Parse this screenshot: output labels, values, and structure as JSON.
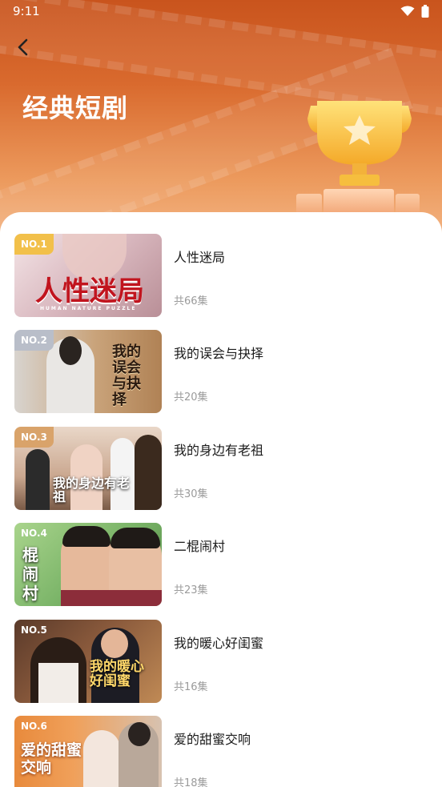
{
  "status_bar": {
    "time": "9:11"
  },
  "header": {
    "title": "经典短剧"
  },
  "items": [
    {
      "rank": "NO.1",
      "title": "人性迷局",
      "episodes": "共66集",
      "poster_title": "人性迷局",
      "poster_subtitle": "HUMAN NATURE PUZZLE",
      "rank_color": "#f2c04a"
    },
    {
      "rank": "NO.2",
      "title": "我的误会与抉择",
      "episodes": "共20集",
      "poster_title": "我的误会与抉择",
      "rank_color": "#b9bec9"
    },
    {
      "rank": "NO.3",
      "title": "我的身边有老祖",
      "episodes": "共30集",
      "poster_title": "我的身边有老祖",
      "rank_color": "#d9a36a"
    },
    {
      "rank": "NO.4",
      "title": "二棍闹村",
      "episodes": "共23集",
      "poster_title": "棍闹村",
      "rank_color": "rgba(0,0,0,0)"
    },
    {
      "rank": "NO.5",
      "title": "我的暖心好闺蜜",
      "episodes": "共16集",
      "poster_title": "我的暖心好闺蜜",
      "rank_color": "rgba(0,0,0,0)"
    },
    {
      "rank": "NO.6",
      "title": "爱的甜蜜交响",
      "episodes": "共18集",
      "poster_title": "爱的甜蜜交响",
      "rank_color": "rgba(0,0,0,0)"
    }
  ]
}
